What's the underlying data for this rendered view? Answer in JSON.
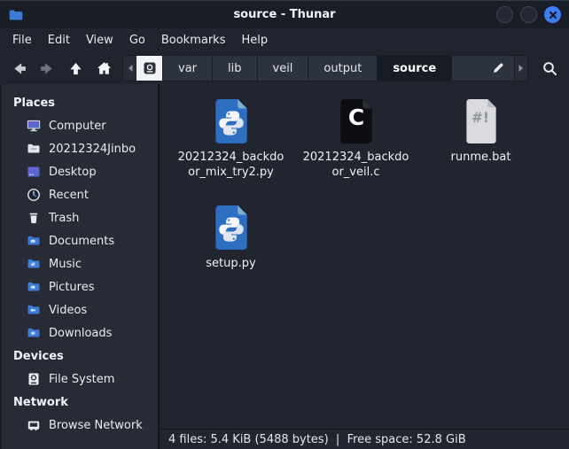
{
  "window": {
    "title": "source - Thunar"
  },
  "menubar": {
    "items": [
      "File",
      "Edit",
      "View",
      "Go",
      "Bookmarks",
      "Help"
    ]
  },
  "toolbar": {
    "breadcrumbs": [
      "var",
      "lib",
      "veil",
      "output",
      "source"
    ],
    "active_breadcrumb": "source"
  },
  "sidebar": {
    "sections": [
      {
        "header": "Places",
        "items": [
          {
            "label": "Computer"
          },
          {
            "label": "20212324Jinbo"
          },
          {
            "label": "Desktop"
          },
          {
            "label": "Recent"
          },
          {
            "label": "Trash"
          },
          {
            "label": "Documents"
          },
          {
            "label": "Music"
          },
          {
            "label": "Pictures"
          },
          {
            "label": "Videos"
          },
          {
            "label": "Downloads"
          }
        ]
      },
      {
        "header": "Devices",
        "items": [
          {
            "label": "File System"
          }
        ]
      },
      {
        "header": "Network",
        "items": [
          {
            "label": "Browse Network"
          }
        ]
      }
    ]
  },
  "files": [
    {
      "name": "20212324_backdoor_mix_try2.py",
      "type": "python"
    },
    {
      "name": "20212324_backdoor_veil.c",
      "type": "c-source"
    },
    {
      "name": "runme.bat",
      "type": "script"
    },
    {
      "name": "setup.py",
      "type": "python"
    }
  ],
  "statusbar": {
    "text": "4 files: 5.4 KiB (5488 bytes)  |  Free space: 52.8 GiB"
  },
  "colors": {
    "accent_blue": "#3d7ded",
    "folder_blue": "#3d7bd7",
    "python_blue": "#2d6ec0",
    "titlebar_bg": "#191d26",
    "sidebar_bg": "#262b36",
    "main_bg": "#21252f"
  }
}
